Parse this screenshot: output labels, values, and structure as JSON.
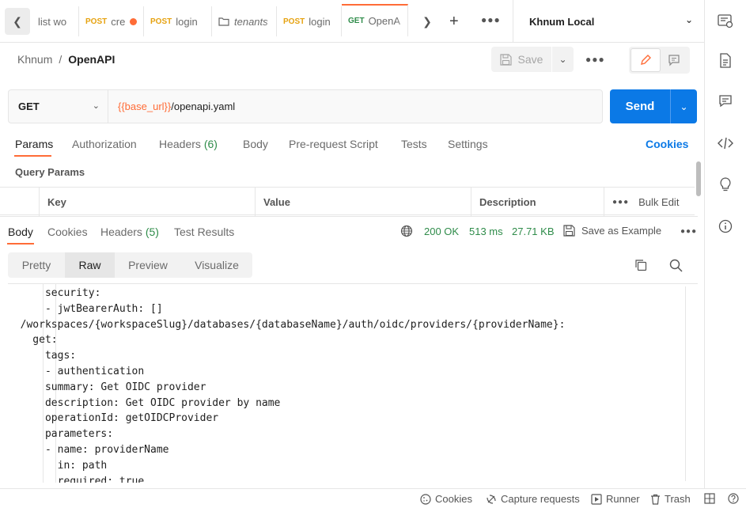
{
  "tabs": [
    {
      "method": "",
      "label": "list wo",
      "italic": false
    },
    {
      "method": "POST",
      "label": "cre",
      "dirty": true
    },
    {
      "method": "POST",
      "label": "login"
    },
    {
      "method": "",
      "label": "tenants",
      "italic": true
    },
    {
      "method": "POST",
      "label": "login"
    },
    {
      "method": "GET",
      "label": "OpenA",
      "active": true
    }
  ],
  "environment": "Khnum Local",
  "breadcrumb": {
    "collection": "Khnum",
    "separator": "/",
    "request": "OpenAPI"
  },
  "toolbar": {
    "save_label": "Save"
  },
  "request": {
    "method": "GET",
    "url_variable": "{{base_url}}",
    "url_path": "/openapi.yaml",
    "send_label": "Send"
  },
  "request_tabs": {
    "params": "Params",
    "authorization": "Authorization",
    "headers": "Headers",
    "headers_count": "(6)",
    "body": "Body",
    "prerequest": "Pre-request Script",
    "tests": "Tests",
    "settings": "Settings",
    "cookies": "Cookies"
  },
  "query_params": {
    "title": "Query Params",
    "columns": {
      "key": "Key",
      "value": "Value",
      "description": "Description",
      "bulk_edit": "Bulk Edit"
    }
  },
  "response_tabs": {
    "body": "Body",
    "cookies": "Cookies",
    "headers": "Headers",
    "headers_count": "(5)",
    "test_results": "Test Results"
  },
  "response_status": {
    "status": "200 OK",
    "time": "513 ms",
    "size": "27.71 KB",
    "save_example": "Save as Example"
  },
  "response_views": {
    "pretty": "Pretty",
    "raw": "Raw",
    "preview": "Preview",
    "visualize": "Visualize"
  },
  "code_lines": [
    "      security:",
    "      - jwtBearerAuth: []",
    "  /workspaces/{workspaceSlug}/databases/{databaseName}/auth/oidc/providers/{providerName}:",
    "    get:",
    "      tags:",
    "      - authentication",
    "      summary: Get OIDC provider",
    "      description: Get OIDC provider by name",
    "      operationId: getOIDCProvider",
    "      parameters:",
    "      - name: providerName",
    "        in: path",
    "        required: true"
  ],
  "footer": {
    "cookies": "Cookies",
    "capture": "Capture requests",
    "runner": "Runner",
    "trash": "Trash"
  },
  "colors": {
    "accent": "#ff6c37",
    "primary": "#0b79e6",
    "success": "#2f8c4a",
    "post": "#e6a210"
  }
}
